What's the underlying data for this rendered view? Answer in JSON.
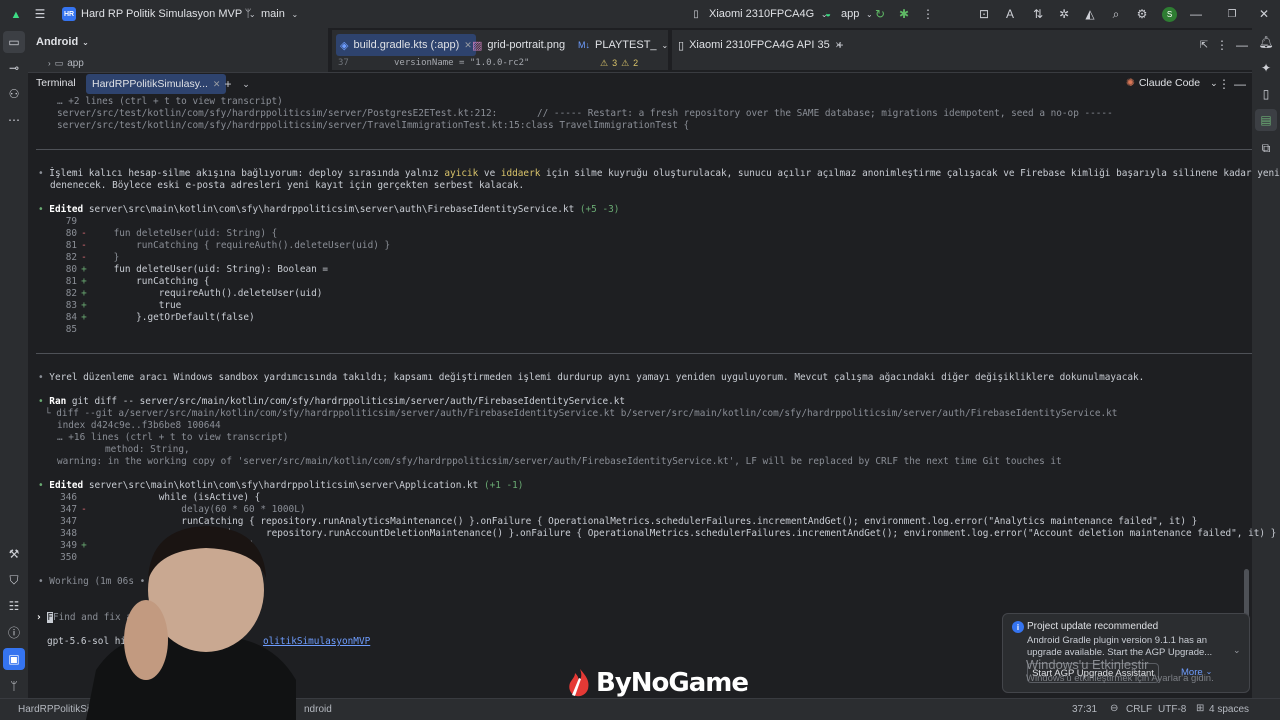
{
  "titlebar": {
    "project_badge": "HR",
    "project_name": "Hard RP Politik Simulasyon MVP",
    "branch": "main",
    "device": "Xiaomi 2310FPCA4G",
    "run_config": "app",
    "colors": {
      "accent": "#3574f0",
      "avatar": "#2e7d32"
    }
  },
  "project_panel": {
    "view_selector": "Android",
    "app_node": "app"
  },
  "editor_tabs": [
    {
      "label": "build.gradle.kts (:app)",
      "active": true
    },
    {
      "label": "grid-portrait.png",
      "active": false
    },
    {
      "label": "PLAYTEST_",
      "active": false
    }
  ],
  "device_tab": {
    "label": "Xiaomi 2310FPCA4G API 35"
  },
  "editor_peek": {
    "line_no": "37",
    "code": "versionName = \"1.0.0-rc2\"",
    "warnings": "3",
    "weak": "2"
  },
  "terminal": {
    "title": "Terminal",
    "session_tab": "HardRPPolitikSimulasy...",
    "plugin": "Claude Code",
    "lines": {
      "l1": "… +2 lines (ctrl + t to view transcript)",
      "l2a": "server/src/test/kotlin/com/sfy/hardrppoliticsim/server/PostgresE2ETest.kt:212:",
      "l2b": "// ----- Restart: a fresh repository over the SAME database; migrations idempotent, seed a no-op -----",
      "l3": "server/src/test/kotlin/com/sfy/hardrppoliticsim/server/TravelImmigrationTest.kt:15:class TravelImmigrationTest {",
      "msg1a": "İşlemi kalıcı hesap-silme akışına bağlıyorum: deploy sırasında yalnız ",
      "msg1_ayicik": "ayicik",
      "msg1_ve": " ve ",
      "msg1_iddaerk": "iddaerk",
      "msg1b": " için silme kuyruğu oluşturulacak, sunucu açılır açılmaz anonimleştirme çalışacak ve Firebase kimliği başarıyla silinene kadar yeniden",
      "msg1c": "denenecek. Böylece eski e-posta adresleri yeni kayıt için gerçekten serbest kalacak.",
      "edit1_label": "Edited",
      "edit1_path": "server\\src\\main\\kotlin\\com\\sfy\\hardrppoliticsim\\server\\auth\\FirebaseIdentityService.kt",
      "edit1_stats": "(+5 -3)",
      "msg2": "Yerel düzenleme aracı Windows sandbox yardımcısında takıldı; kapsamı değiştirmeden işlemi durdurup aynı yamayı yeniden uyguluyorum. Mevcut çalışma ağacındaki diğer değişikliklere dokunulmayacak.",
      "ran_label": "Ran",
      "ran_cmd": "git diff -- server/src/main/kotlin/com/sfy/hardrppoliticsim/server/auth/FirebaseIdentityService.kt",
      "diff1": "└ diff --git a/server/src/main/kotlin/com/sfy/hardrppoliticsim/server/auth/FirebaseIdentityService.kt b/server/src/main/kotlin/com/sfy/hardrppoliticsim/server/auth/FirebaseIdentityService.kt",
      "diff2": "index d424c9e..f3b6be8 100644",
      "diff3": "… +16 lines (ctrl + t to view transcript)",
      "diff4": "method: String,",
      "diff5": "warning: in the working copy of 'server/src/main/kotlin/com/sfy/hardrppoliticsim/server/auth/FirebaseIdentityService.kt', LF will be replaced by CRLF the next time Git touches it",
      "edit2_label": "Edited",
      "edit2_path": "server\\src\\main\\kotlin\\com\\sfy\\hardrppoliticsim\\server\\Application.kt",
      "edit2_stats": "(+1 -1)",
      "working": "Working (1m 06s • esc",
      "prompt": "Find and fix a bug in",
      "model": "gpt-5.6-sol high ·",
      "path_suffix": "olitikSimulasyonMVP",
      "path_prefix": "C:\\"
    },
    "diff1_rows": [
      {
        "n": "79",
        "s": "",
        "code": ""
      },
      {
        "n": "80",
        "s": "-",
        "code": "    fun deleteUser(uid: String) {"
      },
      {
        "n": "81",
        "s": "-",
        "code": "        runCatching { requireAuth().deleteUser(uid) }"
      },
      {
        "n": "82",
        "s": "-",
        "code": "    }"
      },
      {
        "n": "80",
        "s": "+",
        "code": "    fun deleteUser(uid: String): Boolean ="
      },
      {
        "n": "81",
        "s": "+",
        "code": "        runCatching {"
      },
      {
        "n": "82",
        "s": "+",
        "code": "            requireAuth().deleteUser(uid)"
      },
      {
        "n": "83",
        "s": "+",
        "code": "            true"
      },
      {
        "n": "84",
        "s": "+",
        "code": "        }.getOrDefault(false)"
      },
      {
        "n": "85",
        "s": "",
        "code": ""
      }
    ],
    "diff2_rows": [
      {
        "n": "346",
        "s": "",
        "code": "            while (isActive) {"
      },
      {
        "n": "347",
        "s": "-",
        "code": "                delay(60 * 60 * 1000L)"
      },
      {
        "n": "347",
        "s": "",
        "code": "                runCatching { repository.runAnalyticsMaintenance() }.onFailure { OperationalMetrics.schedulerFailures.incrementAndGet(); environment.log.error(\"Analytics maintenance failed\", it) }"
      },
      {
        "n": "348",
        "s": "",
        "code": "                runCatchi      repository.runAccountDeletionMaintenance() }.onFailure { OperationalMetrics.schedulerFailures.incrementAndGet(); environment.log.error(\"Account deletion maintenance failed\", it) }"
      },
      {
        "n": "349",
        "s": "+",
        "code": "                delay      0)"
      },
      {
        "n": "350",
        "s": "",
        "code": "            }"
      }
    ]
  },
  "notification": {
    "title": "Project update recommended",
    "body": "Android Gradle plugin version 9.1.1 has an upgrade available. Start the AGP Upgrade...",
    "action": "Start AGP Upgrade Assistant",
    "more": "More"
  },
  "watermark": {
    "line1": "Windows'u Etkinleştir",
    "line2": "Windows'u etkinleştirmek için Ayarlar'a gidin."
  },
  "logo": {
    "text": "ByNoGame"
  },
  "statusbar": {
    "left": "HardRPPolitikSi",
    "mid": "ndroid",
    "position": "37:31",
    "line_sep": "CRLF",
    "encoding": "UTF-8",
    "indent": "4 spaces"
  }
}
